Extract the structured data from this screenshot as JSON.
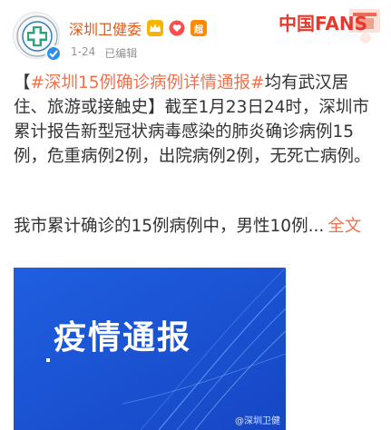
{
  "user": {
    "name": "深圳卫健委",
    "fans_badge": "超",
    "timestamp": "1-24",
    "edited": "已编辑"
  },
  "banner": {
    "text": "中国FANS"
  },
  "post": {
    "topic": "#深圳15例确诊病例详情通报#",
    "bracket_open": "【",
    "topic_suffix": "均有武汉居住、旅游或接触史",
    "bracket_close": "】",
    "body": "截至1月23日24时，深圳市累计报告新型冠状病毒感染的肺炎确诊病例15例，危重病例2例，出院病例2例，无死亡病例。",
    "preview": "我市累计确诊的15例病例中，男性10例...",
    "more": "全文"
  },
  "image": {
    "title": "疫情通报",
    "watermark": "@深圳卫健"
  },
  "colors": {
    "username": "#e05a19",
    "topic": "#eb7350",
    "image_bg": "#1b56d8"
  }
}
